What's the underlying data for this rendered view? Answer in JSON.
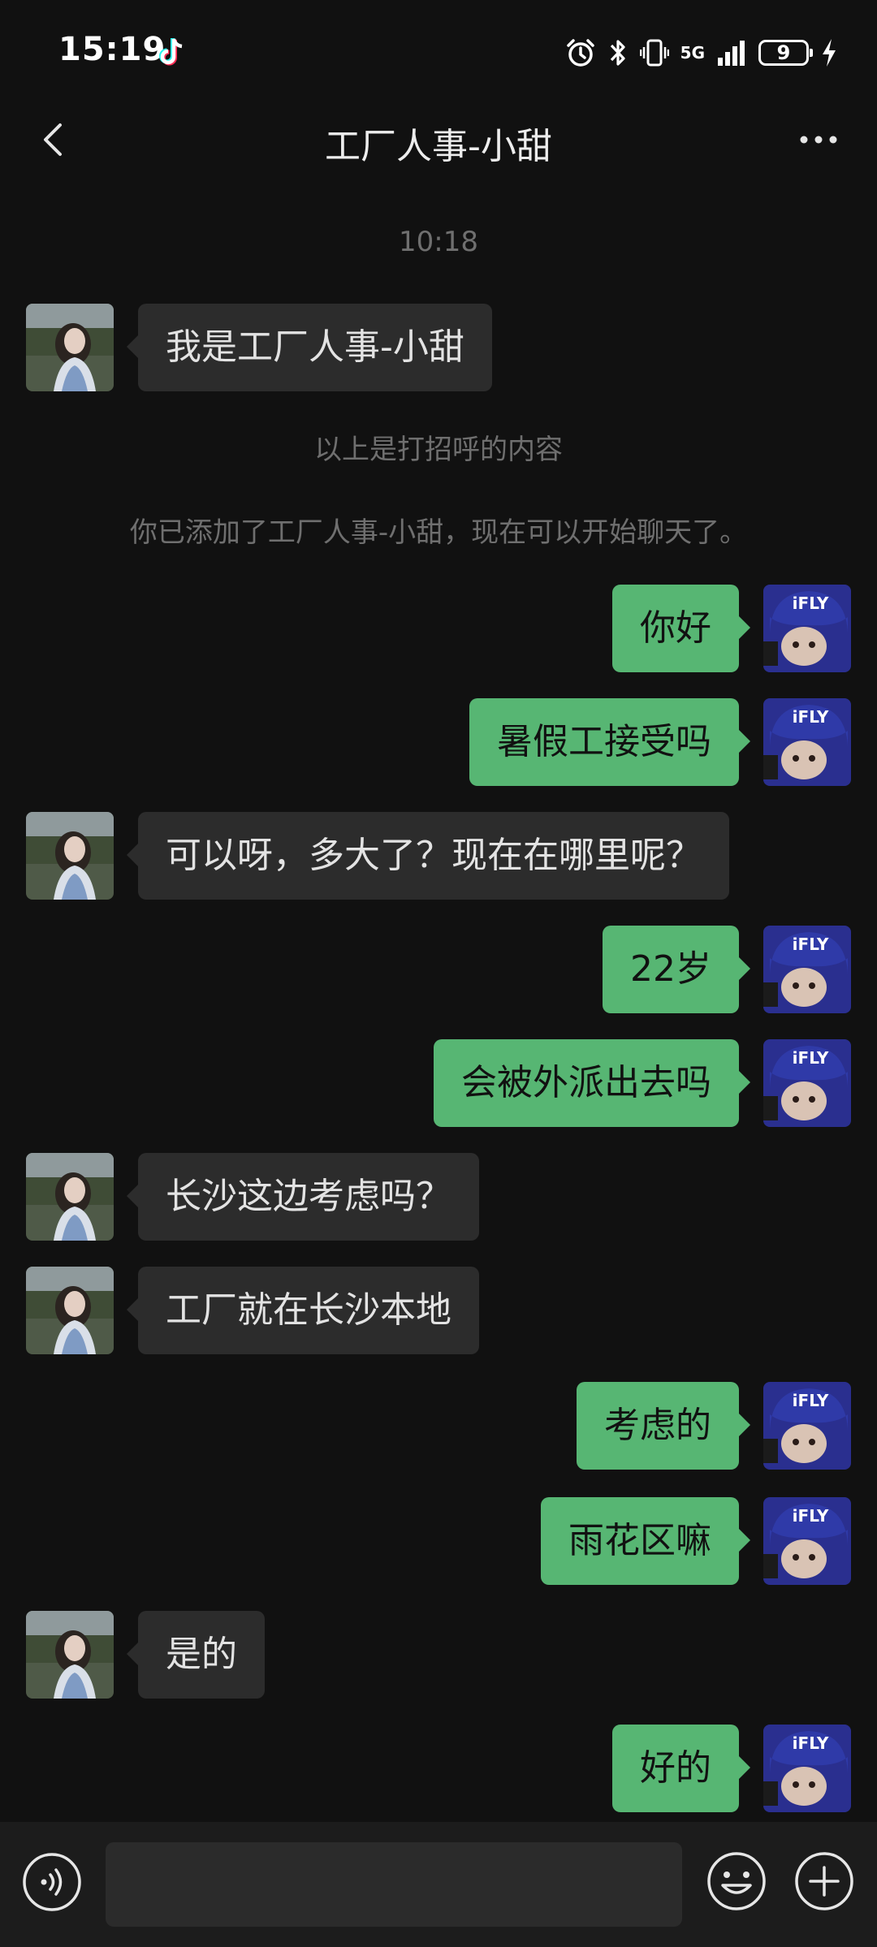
{
  "status_bar": {
    "time": "15:19",
    "network": "5G",
    "battery_level": "9"
  },
  "header": {
    "title": "工厂人事-小甜"
  },
  "messages": [
    {
      "type": "time",
      "text": "10:18"
    },
    {
      "type": "in",
      "text": "我是工厂人事-小甜"
    },
    {
      "type": "system",
      "text": "以上是打招呼的内容"
    },
    {
      "type": "system",
      "text": "你已添加了工厂人事-小甜，现在可以开始聊天了。"
    },
    {
      "type": "out",
      "text": "你好"
    },
    {
      "type": "out",
      "text": "暑假工接受吗"
    },
    {
      "type": "in",
      "text": "可以呀，多大了？现在在哪里呢？"
    },
    {
      "type": "out",
      "text": "22岁"
    },
    {
      "type": "out",
      "text": "会被外派出去吗"
    },
    {
      "type": "in",
      "text": "长沙这边考虑吗？"
    },
    {
      "type": "in",
      "text": "工厂就在长沙本地"
    },
    {
      "type": "out",
      "text": "考虑的"
    },
    {
      "type": "out",
      "text": "雨花区嘛"
    },
    {
      "type": "in",
      "text": "是的"
    },
    {
      "type": "out",
      "text": "好的"
    }
  ],
  "input": {
    "value": ""
  },
  "colors": {
    "background": "#111111",
    "outgoing_bubble": "#57b673",
    "incoming_bubble": "#2c2c2c",
    "system_text": "#6f6f6f"
  },
  "icons": {
    "back": "chevron-left-icon",
    "more": "more-dots-icon",
    "voice": "voice-icon",
    "emoji": "emoji-icon",
    "plus": "plus-icon",
    "tiktok": "tiktok-icon",
    "alarm": "alarm-icon",
    "bluetooth": "bluetooth-icon",
    "vibrate": "vibrate-icon",
    "signal": "signal-icon",
    "charging": "charging-icon"
  }
}
